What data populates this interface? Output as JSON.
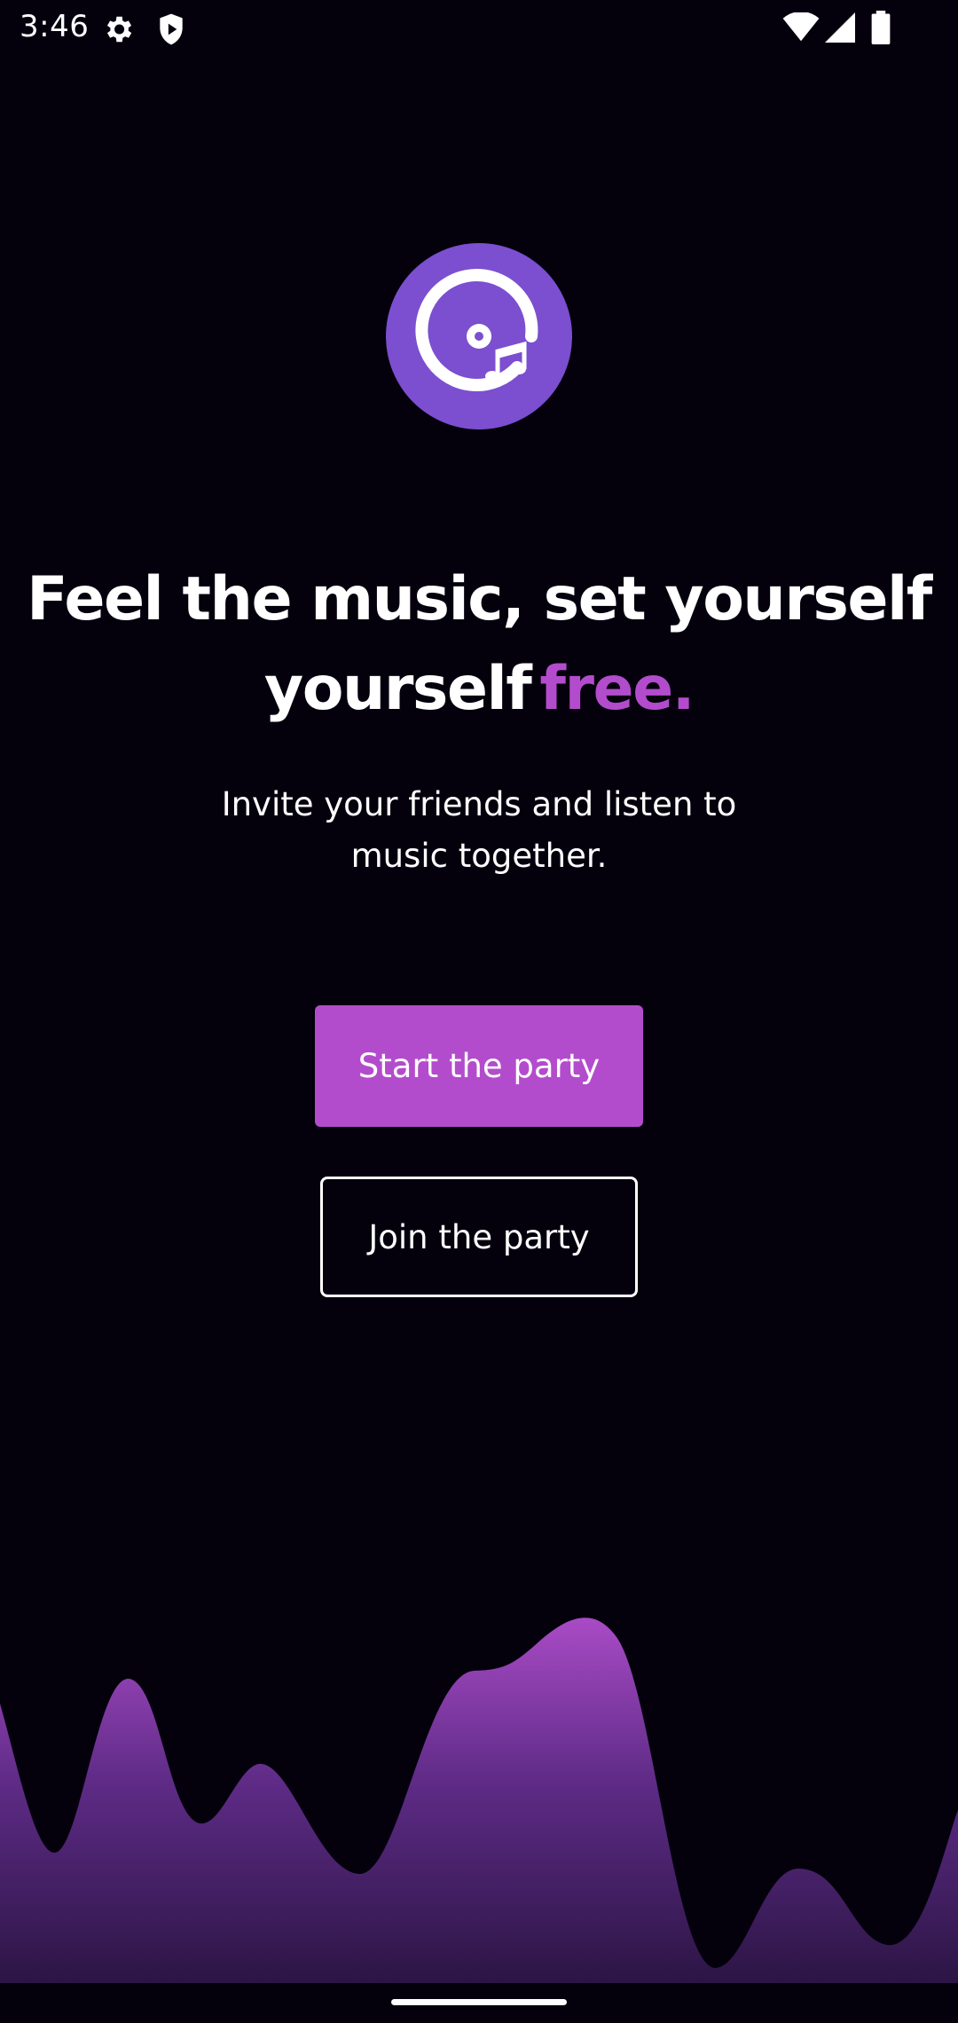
{
  "status_bar": {
    "time": "3:46",
    "icons": [
      "settings-icon",
      "shield-icon",
      "wifi-icon",
      "signal-icon",
      "battery-icon"
    ]
  },
  "logo": {
    "icon": "music-disc-icon",
    "color": "#7b4fcf"
  },
  "headline": {
    "line1": "Feel the music, set yourself",
    "line2_main": "yourself",
    "line2_accent": "free."
  },
  "subtitle": {
    "line1": "Invite your friends and listen to",
    "line2": "music together."
  },
  "buttons": {
    "start_label": "Start the party",
    "join_label": "Join the party"
  },
  "colors": {
    "background": "#04010d",
    "accent": "#b34ccc",
    "wave_top": "#a94bc6",
    "wave_bottom": "#2c1545"
  }
}
